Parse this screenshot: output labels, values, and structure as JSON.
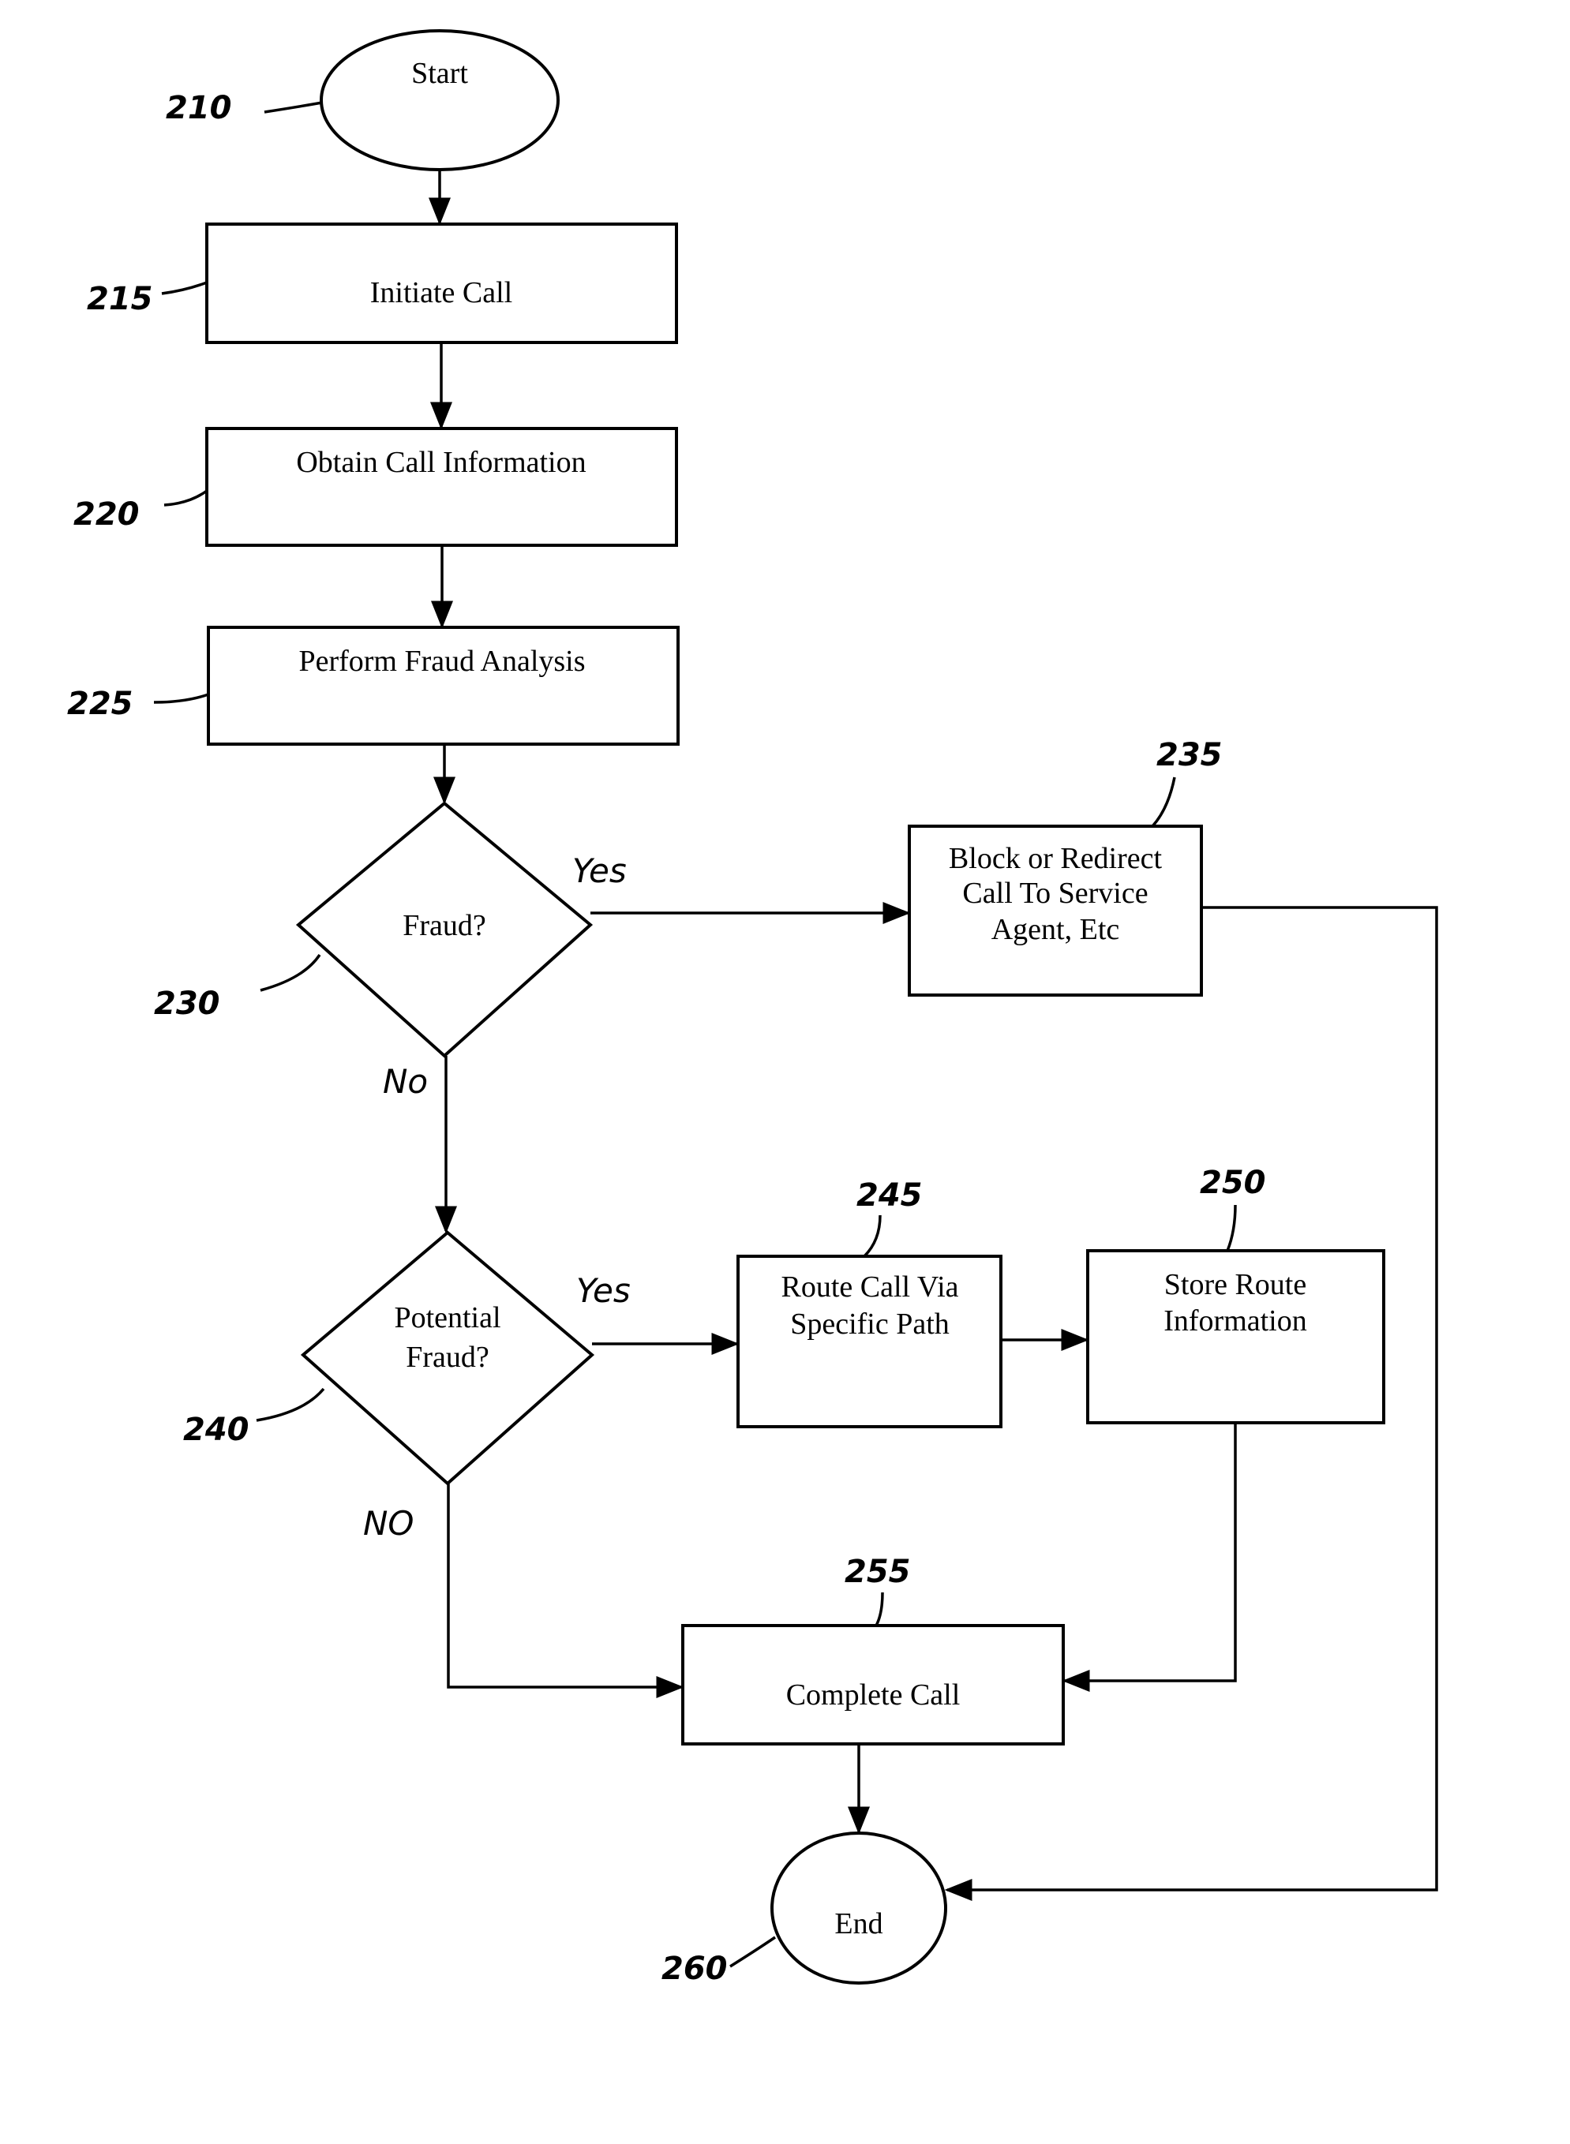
{
  "nodes": {
    "start": {
      "ref": "210",
      "text": "Start"
    },
    "initiate": {
      "ref": "215",
      "text": "Initiate Call"
    },
    "obtain": {
      "ref": "220",
      "text": "Obtain Call Information"
    },
    "analysis": {
      "ref": "225",
      "text": "Perform Fraud Analysis"
    },
    "fraud": {
      "ref": "230",
      "text": "Fraud?"
    },
    "block": {
      "ref": "235",
      "lines": [
        "Block or Redirect",
        "Call To Service",
        "Agent, Etc"
      ]
    },
    "potential": {
      "ref": "240",
      "lines": [
        "Potential",
        "Fraud?"
      ]
    },
    "route": {
      "ref": "245",
      "lines": [
        "Route Call Via",
        "Specific Path"
      ]
    },
    "store": {
      "ref": "250",
      "lines": [
        "Store Route",
        "Information"
      ]
    },
    "complete": {
      "ref": "255",
      "text": "Complete Call"
    },
    "end": {
      "ref": "260",
      "text": "End"
    }
  },
  "edge_labels": {
    "fraud_yes": "Yes",
    "fraud_no": "No",
    "potential_yes": "Yes",
    "potential_no": "NO"
  }
}
